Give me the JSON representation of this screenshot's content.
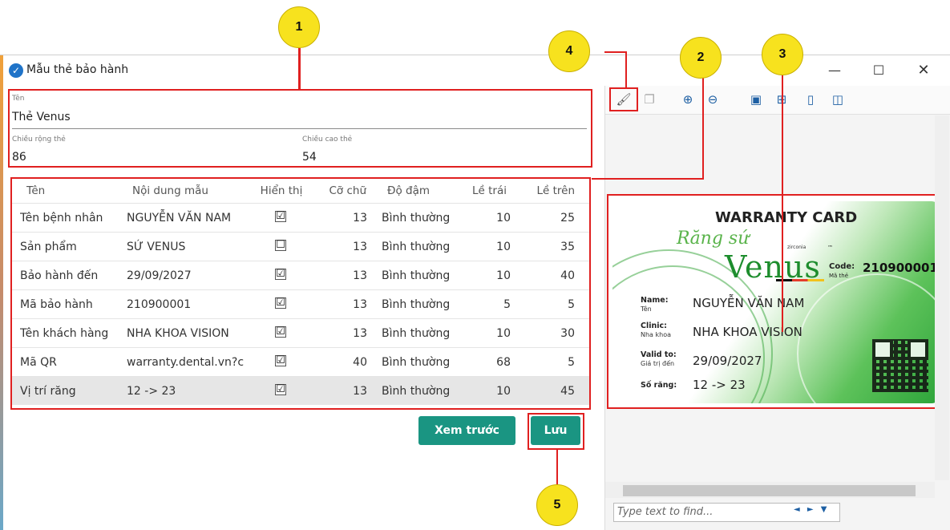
{
  "window": {
    "title": "Mẫu thẻ bảo hành",
    "controls": {
      "minimize": "—",
      "maximize": "☐",
      "close": "✕"
    }
  },
  "form": {
    "name_label": "Tên",
    "name_value": "Thẻ Venus",
    "width_label": "Chiều rộng thẻ",
    "width_value": "86",
    "height_label": "Chiều cao thẻ",
    "height_value": "54"
  },
  "grid": {
    "headers": [
      "Tên",
      "Nội dung mẫu",
      "Hiển thị",
      "Cỡ chữ",
      "Độ đậm",
      "Lề trái",
      "Lề trên"
    ],
    "rows": [
      {
        "name": "Tên bệnh nhân",
        "content": "NGUYỄN VĂN NAM",
        "show": "☑",
        "font": "13",
        "weight": "Bình thường",
        "left": "10",
        "top": "25"
      },
      {
        "name": "Sản phẩm",
        "content": "SỨ VENUS",
        "show": "☐",
        "font": "13",
        "weight": "Bình thường",
        "left": "10",
        "top": "35"
      },
      {
        "name": "Bảo hành đến",
        "content": "29/09/2027",
        "show": "☑",
        "font": "13",
        "weight": "Bình thường",
        "left": "10",
        "top": "40"
      },
      {
        "name": "Mã bảo hành",
        "content": "210900001",
        "show": "☑",
        "font": "13",
        "weight": "Bình thường",
        "left": "5",
        "top": "5"
      },
      {
        "name": "Tên khách hàng",
        "content": "NHA KHOA VISION",
        "show": "☑",
        "font": "13",
        "weight": "Bình thường",
        "left": "10",
        "top": "30"
      },
      {
        "name": "Mã QR",
        "content": "warranty.dental.vn?c",
        "show": "☑",
        "font": "40",
        "weight": "Bình thường",
        "left": "68",
        "top": "5"
      },
      {
        "name": "Vị trí răng",
        "content": "12 -> 23",
        "show": "☑",
        "font": "13",
        "weight": "Bình thường",
        "left": "10",
        "top": "45"
      }
    ]
  },
  "buttons": {
    "preview": "Xem trước",
    "save": "Lưu"
  },
  "preview": {
    "find_placeholder": "Type text to find...",
    "find_nav": "◄ ► ▼",
    "toolbar_icons": [
      "print-icon",
      "copy-icon",
      "zoom-in-icon",
      "zoom-out-icon",
      "fit-page-icon",
      "fit-width-icon",
      "single-page-icon",
      "two-page-icon"
    ],
    "card": {
      "title": "WARRANTY CARD",
      "brand_script": "Răng sứ",
      "brand": "Venus",
      "brand_sub": "zirconia",
      "tm": "™",
      "code_label": "Code:",
      "code_sub": "Mã thẻ",
      "code_value": "210900001",
      "name_label": "Name:",
      "name_sub": "Tên",
      "name_value": "NGUYỄN VĂN NAM",
      "clinic_label": "Clinic:",
      "clinic_sub": "Nha khoa",
      "clinic_value": "NHA KHOA VISION",
      "valid_label": "Valid to:",
      "valid_sub": "Giá trị đến",
      "valid_value": "29/09/2027",
      "teeth_label": "Số răng:",
      "teeth_value": "12 -> 23"
    }
  },
  "callouts": [
    "1",
    "2",
    "3",
    "4",
    "5"
  ]
}
